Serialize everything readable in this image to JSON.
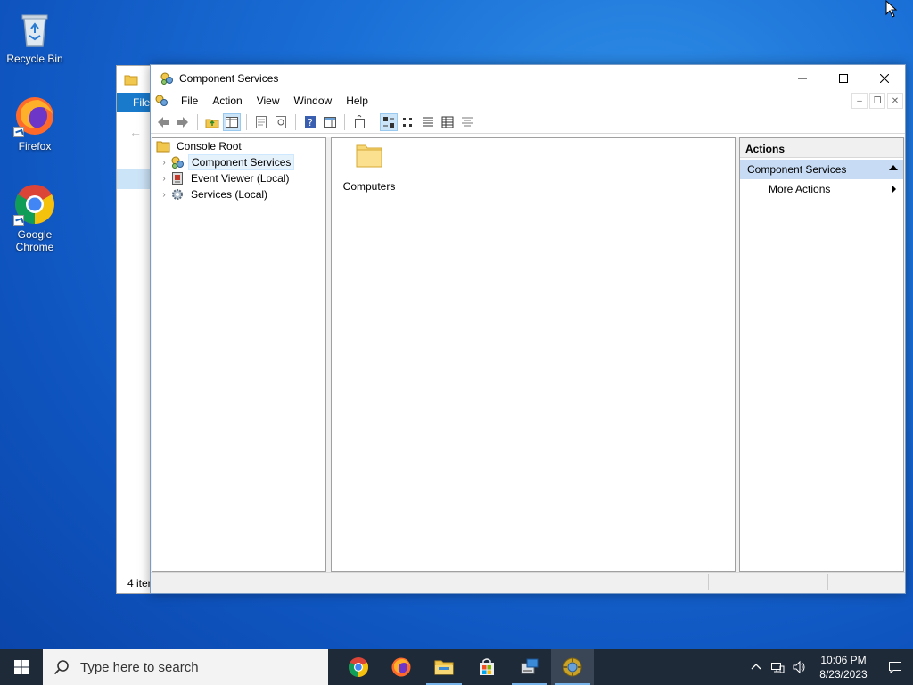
{
  "desktop": {
    "icons": [
      {
        "label": "Recycle Bin"
      },
      {
        "label": "Firefox"
      },
      {
        "label": "Google Chrome"
      }
    ]
  },
  "bg_window": {
    "ribbon_tab": "File",
    "status": "4 iter"
  },
  "window": {
    "title": "Component Services",
    "menu": [
      "File",
      "Action",
      "View",
      "Window",
      "Help"
    ],
    "tree": [
      {
        "label": "Console Root"
      },
      {
        "label": "Component Services"
      },
      {
        "label": "Event Viewer (Local)"
      },
      {
        "label": "Services (Local)"
      }
    ],
    "content_items": [
      {
        "label": "Computers"
      }
    ],
    "actions": {
      "header": "Actions",
      "section": "Component Services",
      "items": [
        "More Actions"
      ]
    }
  },
  "taskbar": {
    "search_placeholder": "Type here to search",
    "time": "10:06 PM",
    "date": "8/23/2023"
  },
  "colors": {
    "selection_bg": "#c7dcf4",
    "taskbar_bg": "#1f2a38",
    "accent": "#1979ca"
  }
}
